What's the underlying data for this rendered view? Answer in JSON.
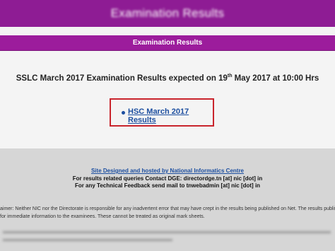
{
  "top_header": {
    "title": "Examination Results"
  },
  "bar": {
    "title": "Examination Results"
  },
  "headline": {
    "prefix": "SSLC March 2017 Examination Results expected on 19",
    "superscript": "th",
    "suffix": " May 2017 at 10:00 Hrs"
  },
  "result_link": {
    "label": "HSC March 2017 Results"
  },
  "footer": {
    "designed_by": "Site Designed and hosted by National Informatics Centre",
    "queries": "For results related queries Contact DGE:  directordge.tn [at] nic [dot] in",
    "feedback": "For any Technical Feedback send mail to tnwebadmin [at] nic [dot] in",
    "disclaimer_line1": "aimer: Neither NIC nor the Directorate is responsible for any inadvertent error that may have crept in the results being published on Net. The results published on",
    "disclaimer_line2": "for immediate information to the examinees. These cannot be treated as original mark sheets."
  },
  "colors": {
    "header_purple": "#8e1c94",
    "bar_purple": "#9c1c9c",
    "link_blue": "#1d4fa0",
    "highlight_red": "#c9242c",
    "footer_gray": "#d6d6d6"
  }
}
